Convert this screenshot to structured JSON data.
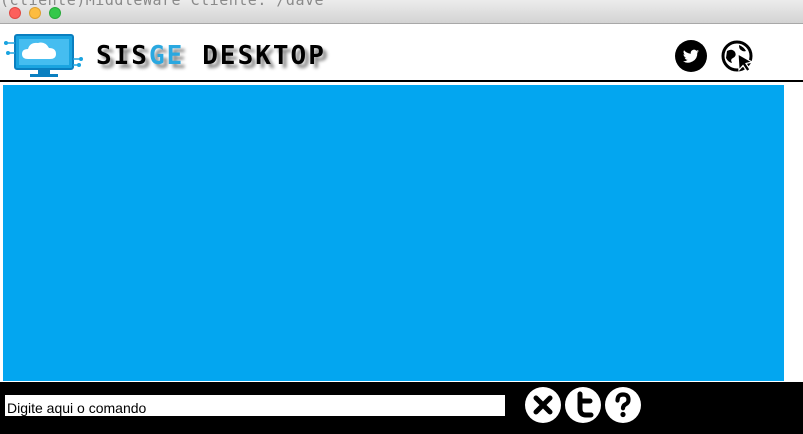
{
  "window": {
    "background_title": "(cliente)MiddleWare Cliente: /dave"
  },
  "header": {
    "brand_part1": "SIS",
    "brand_accent": "GE",
    "brand_part2": "DESKTOP",
    "accent_color": "#2aa8e0",
    "logo_icon": "cloud-monitor-logo",
    "buttons": [
      {
        "icon": "twitter-icon"
      },
      {
        "icon": "web-cursor-icon"
      }
    ]
  },
  "main": {
    "panel_color": "#03a6f0"
  },
  "bottom": {
    "command_placeholder": "Digite aqui o comando",
    "buttons": [
      {
        "icon": "close-icon"
      },
      {
        "icon": "t-icon"
      },
      {
        "icon": "help-icon"
      }
    ]
  }
}
